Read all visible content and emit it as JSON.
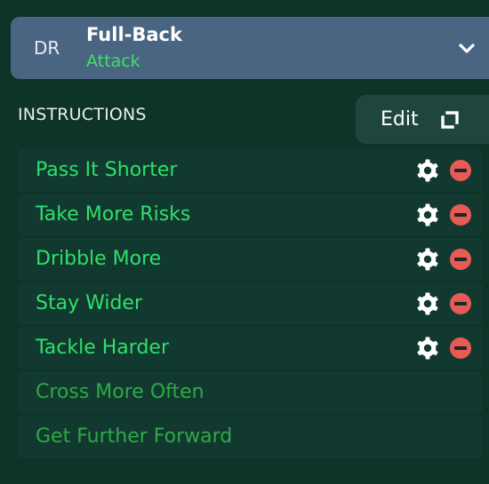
{
  "role": {
    "abbr": "DR",
    "title": "Full-Back",
    "duty": "Attack"
  },
  "instructions": {
    "heading": "INSTRUCTIONS",
    "edit_label": "Edit",
    "selected": [
      {
        "label": "Pass It Shorter"
      },
      {
        "label": "Take More Risks"
      },
      {
        "label": "Dribble More"
      },
      {
        "label": "Stay Wider"
      },
      {
        "label": "Tackle Harder"
      }
    ],
    "available": [
      {
        "label": "Cross More Often"
      },
      {
        "label": "Get Further Forward"
      }
    ]
  },
  "icons": {
    "dropdown": "chevron-down-icon",
    "edit": "expand-icon",
    "settings": "gear-icon",
    "remove": "remove-icon"
  },
  "colors": {
    "background": "#0e3429",
    "row": "#12392f",
    "header_card": "#4a6582",
    "active_text": "#2ee06a",
    "available_text": "#2fa947",
    "duty_text": "#3fe06a",
    "remove": "#e85a55"
  }
}
